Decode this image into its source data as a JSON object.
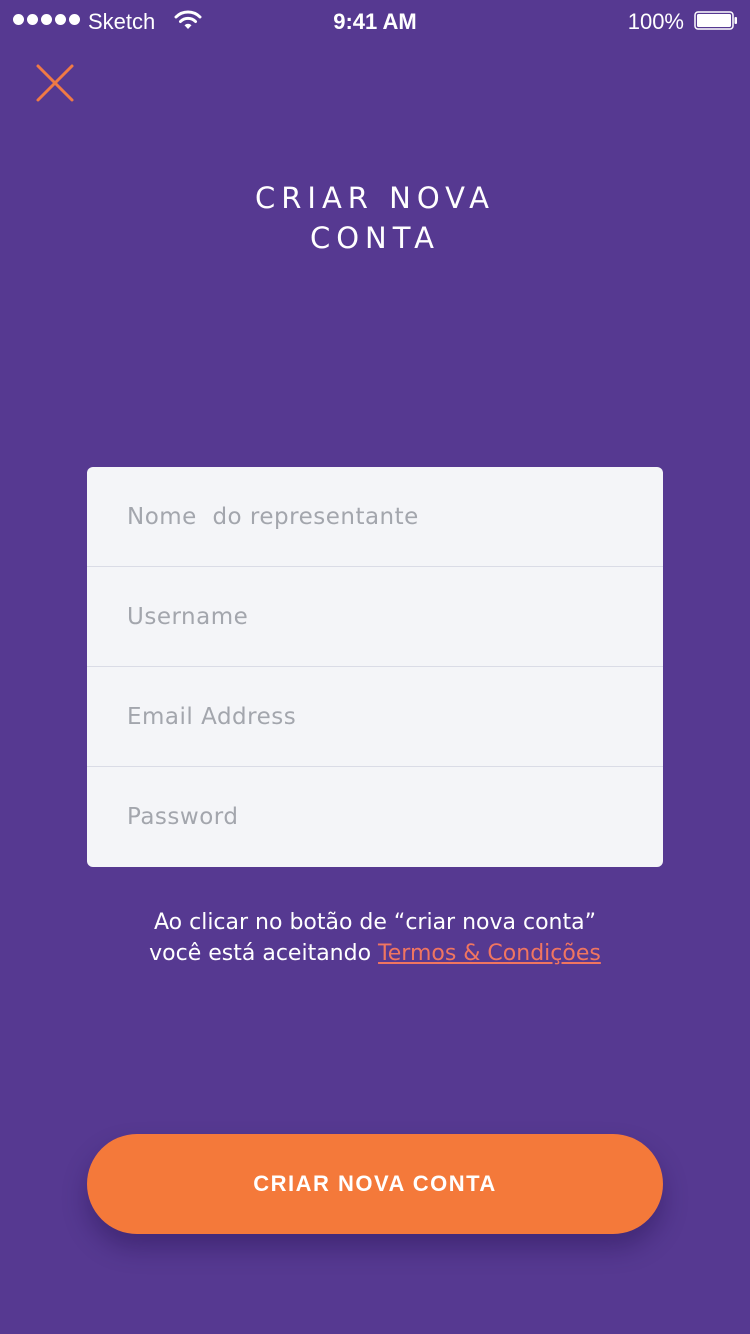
{
  "status_bar": {
    "carrier": "Sketch",
    "time": "9:41 AM",
    "battery": "100%",
    "icons": [
      "signal-dots-icon",
      "wifi-icon",
      "battery-icon"
    ]
  },
  "close_icon": "close-icon",
  "title": {
    "line1": "CRIAR NOVA",
    "line2": "CONTA"
  },
  "form": {
    "name_placeholder": "Nome  do representante",
    "username_placeholder": "Username",
    "email_placeholder": "Email Address",
    "password_placeholder": "Password"
  },
  "terms": {
    "line1": "Ao clicar no botão de “criar nova conta”",
    "line2_prefix": "você está aceitando",
    "link": "Termos & Condições"
  },
  "submit_label": "CRIAR NOVA CONTA",
  "colors": {
    "background": "#563991",
    "accent": "#f4793a",
    "link": "#f07560",
    "card": "#f4f5f8"
  }
}
